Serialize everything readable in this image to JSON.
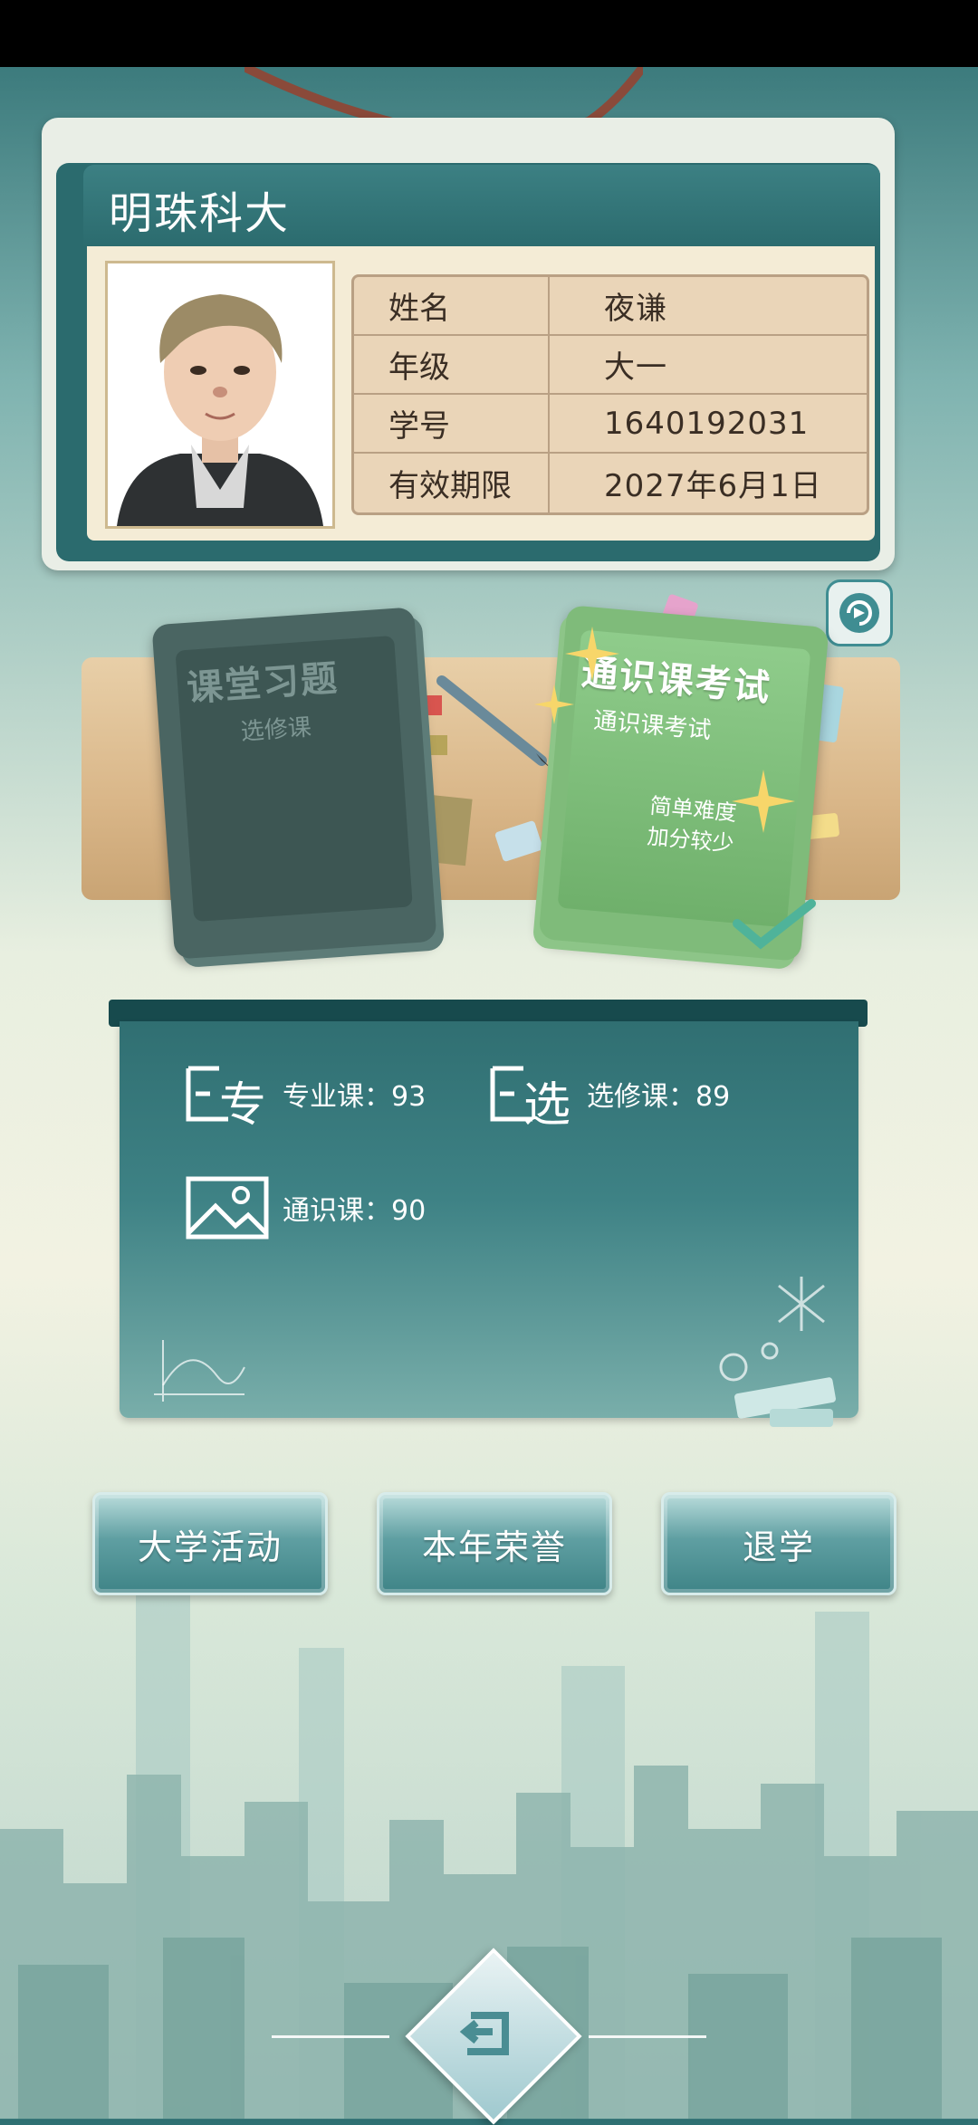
{
  "id_card": {
    "school_name": "明珠科大",
    "fields": [
      {
        "key": "姓名",
        "value": "夜谦"
      },
      {
        "key": "年级",
        "value": "大一"
      },
      {
        "key": "学号",
        "value": "1640192031"
      },
      {
        "key": "有效期限",
        "value": "2027年6月1日"
      }
    ]
  },
  "books": {
    "dark": {
      "title": "课堂习题",
      "subtitle": "选修课"
    },
    "green": {
      "title": "通识课考试",
      "subtitle": "通识课考试",
      "desc_line1": "简单难度",
      "desc_line2": "加分较少"
    }
  },
  "board": {
    "major": {
      "icon_char": "专",
      "label": "专业课：93"
    },
    "elective": {
      "icon_char": "选",
      "label": "选修课：89"
    },
    "general": {
      "label": "通识课：90"
    }
  },
  "buttons": {
    "activities": "大学活动",
    "honors": "本年荣誉",
    "dropout": "退学"
  },
  "icons": {
    "refresh": "refresh-icon",
    "back": "back-arrow-icon"
  }
}
